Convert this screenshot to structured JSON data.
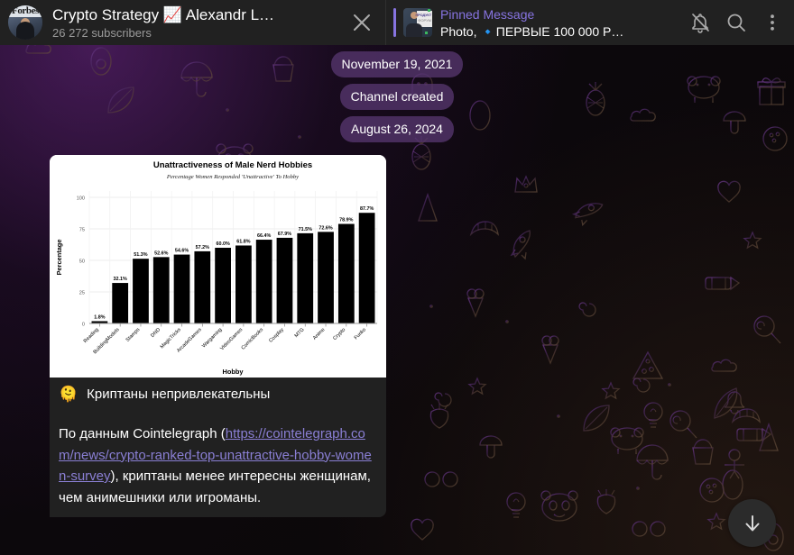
{
  "header": {
    "avatar_name": "forbes-cover-avatar",
    "avatar_text": "Forbes",
    "title": "Crypto Strategy 📈  Alexandr L…",
    "subscribers": "26 272 subscribers",
    "close_icon": "close-icon",
    "pinned": {
      "label": "Pinned Message",
      "description": "Photo, 🔹ПЕРВЫЕ 100 000 Р…",
      "accent_color": "#8774e1"
    },
    "icons": [
      {
        "name": "mute-bell-icon",
        "label": "Mute notifications"
      },
      {
        "name": "search-icon",
        "label": "Search"
      },
      {
        "name": "more-vertical-icon",
        "label": "More options"
      }
    ]
  },
  "messages": {
    "date_chip_1": "November 19, 2021",
    "service_chip": "Channel created",
    "date_chip_2": "August 26, 2024",
    "message": {
      "emoji": "🫠",
      "title": "Криптаны непривлекательны",
      "body_before": "По данным Cointelegraph (",
      "link": "https://cointelegraph.com/news/crypto-ranked-top-unattractive-hobby-women-survey",
      "body_after": "), криптаны менее интересны женщинам, чем анимешники или игроманы."
    }
  },
  "scroll_down": {
    "name": "scroll-to-bottom-button",
    "icon": "arrow-down-icon"
  },
  "colors": {
    "header_bg": "#212121",
    "bubble_bg": "#212121",
    "accent_purple": "#8774e1",
    "link_purple": "#8a7fd4",
    "date_chip_bg": "rgba(86,54,110,0.78)"
  },
  "chart_data": {
    "type": "bar",
    "title": "Unattractiveness of Male Nerd Hobbies",
    "subtitle": "Percentage Women Responded 'Unattractive' To Hobby",
    "xlabel": "Hobby",
    "ylabel": "Percentage",
    "ylim": [
      0,
      105
    ],
    "yticks": [
      0,
      25,
      50,
      75,
      100
    ],
    "grid": true,
    "legend": "none",
    "bar_color": "#000000",
    "plot_bg": "#ffffff",
    "categories": [
      "Reading",
      "BuildingModels",
      "Stamps",
      "DND",
      "MagicTricks",
      "ArcadeGames",
      "Wargaming",
      "VideoGames",
      "ComicBooks",
      "Cosplay",
      "MTG",
      "Anime",
      "Crypto",
      "Funko"
    ],
    "values": [
      1.8,
      32.1,
      51.3,
      52.6,
      54.6,
      57.2,
      60.0,
      61.8,
      66.4,
      67.9,
      71.5,
      72.6,
      78.9,
      87.7
    ],
    "data_labels": [
      "1.8%",
      "32.1%",
      "51.3%",
      "52.6%",
      "54.6%",
      "57.2%",
      "60.0%",
      "61.8%",
      "66.4%",
      "67.9%",
      "71.5%",
      "72.6%",
      "78.9%",
      "87.7%"
    ]
  }
}
